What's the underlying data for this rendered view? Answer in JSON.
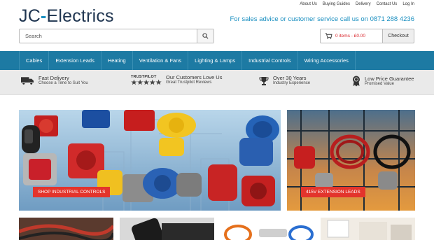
{
  "header": {
    "logo_left": "JC",
    "logo_right": "Electrics",
    "top_links": [
      "About Us",
      "Buying Guides",
      "Delivery",
      "Contact Us",
      "Log In"
    ],
    "phone_text": "For sales advice or customer service call us on",
    "phone_number": "0871 288 4236"
  },
  "search": {
    "placeholder": "Search",
    "button_icon": "magnifier-icon"
  },
  "cart": {
    "items_text": "0 items - £0.00",
    "checkout_label": "Checkout",
    "icon": "cart-icon"
  },
  "nav": {
    "items": [
      "Cables",
      "Extension Leads",
      "Heating",
      "Ventilation & Fans",
      "Lighting & Lamps",
      "Industrial Controls",
      "Wiring Accessories"
    ]
  },
  "usp": [
    {
      "title": "Fast Delivery",
      "subtitle": "Choose a Time to Suit You",
      "icon": "truck-icon"
    },
    {
      "logo": "TRUSTPILOT",
      "title": "Our Customers Love Us",
      "subtitle": "Great Trustpilot Reviews",
      "icon": "star-rating-icon"
    },
    {
      "title": "Over 30 Years",
      "subtitle": "Industry Experience",
      "icon": "trophy-icon"
    },
    {
      "title": "Low Price Guarantee",
      "subtitle": "Promised Value",
      "icon": "award-badge-icon"
    }
  ],
  "banners": [
    {
      "cta": "SHOP INDUSTRIAL CONTROLS"
    },
    {
      "cta": "415V EXTENSION LEADS"
    }
  ],
  "colors": {
    "brand_blue": "#1d7aa3",
    "cta_red": "#e3342c",
    "logo_navy": "#1f3550",
    "accent": "#1a8fc0"
  }
}
